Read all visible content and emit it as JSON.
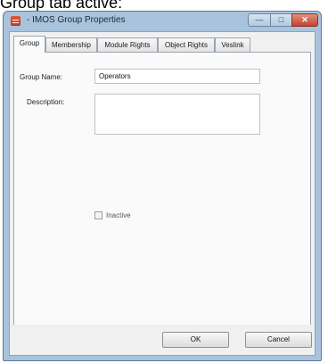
{
  "caption": "Group tab active:",
  "window": {
    "title": "- IMOS Group Properties",
    "controls": {
      "minimize": "—",
      "maximize": "□",
      "close": "✕"
    }
  },
  "tabs": [
    {
      "label": "Group",
      "active": true
    },
    {
      "label": "Membership",
      "active": false
    },
    {
      "label": "Module Rights",
      "active": false
    },
    {
      "label": "Object Rights",
      "active": false
    },
    {
      "label": "Veslink",
      "active": false
    }
  ],
  "form": {
    "group_name_label": "Group Name:",
    "group_name_value": "Operators",
    "description_label": "Description:",
    "description_value": "",
    "inactive_label": "Inactive",
    "inactive_checked": false
  },
  "buttons": {
    "ok": "OK",
    "cancel": "Cancel"
  },
  "colors": {
    "title_bar": "#a9c3dd",
    "close_button": "#c2442c",
    "app_icon": "#e8532f"
  }
}
